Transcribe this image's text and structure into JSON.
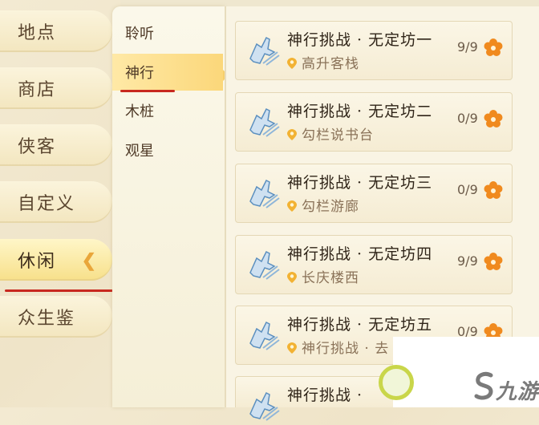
{
  "left_categories": [
    {
      "label": "地点"
    },
    {
      "label": "商店"
    },
    {
      "label": "侠客"
    },
    {
      "label": "自定义"
    },
    {
      "label": "休闲"
    },
    {
      "label": "众生鉴"
    }
  ],
  "selected_category_index": 4,
  "submenu": [
    {
      "label": "聆听"
    },
    {
      "label": "神行"
    },
    {
      "label": "木桩"
    },
    {
      "label": "观星"
    }
  ],
  "selected_submenu_index": 1,
  "tasks": [
    {
      "title": "神行挑战 · 无定坊一",
      "location": "高升客栈",
      "count": "9/9"
    },
    {
      "title": "神行挑战 · 无定坊二",
      "location": "勾栏说书台",
      "count": "0/9"
    },
    {
      "title": "神行挑战 · 无定坊三",
      "location": "勾栏游廊",
      "count": "0/9"
    },
    {
      "title": "神行挑战 · 无定坊四",
      "location": "长庆楼西",
      "count": "9/9"
    },
    {
      "title": "神行挑战 · 无定坊五",
      "location": "神行挑战 · 去",
      "count": "0/9"
    },
    {
      "title": "神行挑战 · ",
      "location": "",
      "count": ""
    }
  ],
  "watermark": {
    "text": "九游"
  },
  "colors": {
    "accent_red": "#c8281f",
    "selected_gold": "#f7e08a",
    "flower_orange": "#f08a1e"
  }
}
